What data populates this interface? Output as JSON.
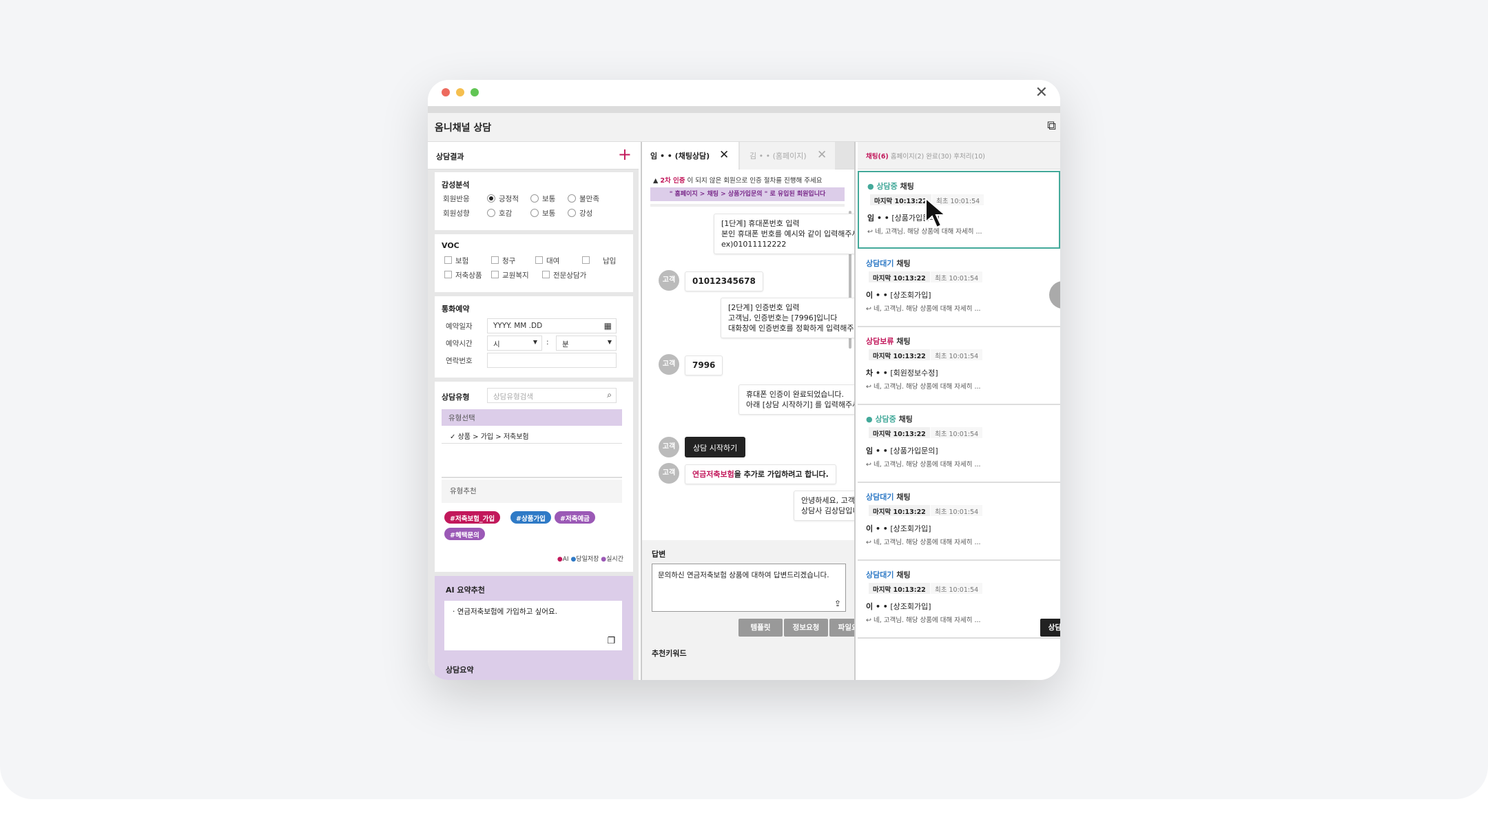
{
  "window": {
    "title": "옴니채널 상담"
  },
  "left": {
    "result_title": "상담결과",
    "sentiment": {
      "title": "감성분석",
      "row1_label": "회원반응",
      "row1_options": [
        "긍정적",
        "보통",
        "불만족"
      ],
      "row2_label": "회원성향",
      "row2_options": [
        "호감",
        "보통",
        "강성"
      ]
    },
    "voc": {
      "title": "VOC",
      "items": [
        "보험",
        "청구",
        "대여",
        "납입",
        "저축상품",
        "교원복지",
        "전문상담가"
      ]
    },
    "reserve": {
      "title": "통화예약",
      "date_label": "예약일자",
      "date_placeholder": "YYYY. MM .DD",
      "time_label": "예약시간",
      "hour": "시",
      "minute": "분",
      "colon": ":",
      "phone_label": "연락번호"
    },
    "type": {
      "title": "상담유형",
      "search_placeholder": "상담유형검색",
      "select_title": "유형선택",
      "selected": "상품 > 가입 > 저축보험",
      "rec_title": "유형추천",
      "tags": [
        "#저축보험_가입",
        "#상품가입",
        "#저축예금",
        "#혜택문의"
      ],
      "legend": [
        "AI",
        "당일저장",
        "실시간"
      ]
    },
    "ai": {
      "title": "AI 요약추천",
      "text": "연금저축보험에 가입하고 싶어요.",
      "summary_title": "상담요약"
    }
  },
  "colors": {
    "accent": "#c2185b",
    "teal": "#43a99a",
    "blue": "#2f7ac6",
    "purple": "#9b59b6",
    "ai_bg": "#dccde9",
    "ai_header": "#cfb8e3"
  },
  "chat": {
    "tab1": "임 • • (채팅상담)",
    "tab2": "김 • • (홈페이지)",
    "notice_prefix": "2차 인증",
    "notice_text": "이 되지 않은 회원으로 인증 절차를 진행해 주세요",
    "banner": "\" 홈페이지 > 채팅 > 상품가입문의 \" 로 유입된 회원입니다",
    "agent_label": "상담",
    "customer_label": "고객",
    "msg1": [
      "[1단계] 휴대폰번호 입력",
      "본인 휴대폰 번호를 예시와 같이 입력해주세요",
      "ex)01011112222"
    ],
    "reply1": "01012345678",
    "msg2": [
      "[2단계] 인증번호 입력",
      "고객님, 인증번호는 [7996]입니다",
      "대화창에 인증번호를 정확하게 입력해주세요"
    ],
    "reply2": "7996",
    "msg3": [
      "휴대폰 인증이 완료되었습니다.",
      "아래 [상담 시작하기] 를 입력해주세요."
    ],
    "start": "상담 시작하기",
    "reply3_hl": "연금저축보험",
    "reply3": "을 추가로 가입하려고 합니다.",
    "msg4": [
      "안녕하세요, 고객님.",
      "상담사 김상담입니다."
    ],
    "answer_title": "답변",
    "answer_text": "문의하신 연금저축보험 상품에 대하여 답변드리겠습니다.",
    "buttons": [
      "템플릿",
      "정보요청",
      "파일요청",
      "상담종료"
    ],
    "keywords_title": "추천키워드"
  },
  "list": {
    "tabs": [
      "채팅(6)",
      "홈페이지(2)",
      "완료(30)",
      "후처리(10)"
    ],
    "cards": [
      {
        "status": "상담중",
        "channel": "채팅",
        "last": "마지막 10:13:22",
        "first": "최초 10:01:54",
        "name": "임 • •",
        "category": "[상품가입문의]",
        "preview": "네, 고객님. 해당 상품에 대해 자세히 ..."
      },
      {
        "status": "상담대기",
        "channel": "채팅",
        "last": "마지막 10:13:22",
        "first": "최초 10:01:54",
        "name": "이 • •",
        "category": "[상조회가입]",
        "preview": "네, 고객님. 해당 상품에 대해 자세히 ..."
      },
      {
        "status": "상담보류",
        "channel": "채팅",
        "last": "마지막 10:13:22",
        "first": "최초 10:01:54",
        "name": "차 • •",
        "category": "[회원정보수정]",
        "preview": "네, 고객님. 해당 상품에 대해 자세히 ..."
      },
      {
        "status": "상담중",
        "channel": "채팅",
        "last": "마지막 10:13:22",
        "first": "최초 10:01:54",
        "name": "임 • •",
        "category": "[상품가입문의]",
        "preview": "네, 고객님. 해당 상품에 대해 자세히 ..."
      },
      {
        "status": "상담대기",
        "channel": "채팅",
        "last": "마지막 10:13:22",
        "first": "최초 10:01:54",
        "name": "이 • •",
        "category": "[상조회가입]",
        "preview": "네, 고객님. 해당 상품에 대해 자세히 ..."
      },
      {
        "status": "상담대기",
        "channel": "채팅",
        "last": "마지막 10:13:22",
        "first": "최초 10:01:54",
        "name": "이 • •",
        "category": "[상조회가입]",
        "preview": "네, 고객님. 해당 상품에 대해 자세히 ..."
      }
    ]
  }
}
